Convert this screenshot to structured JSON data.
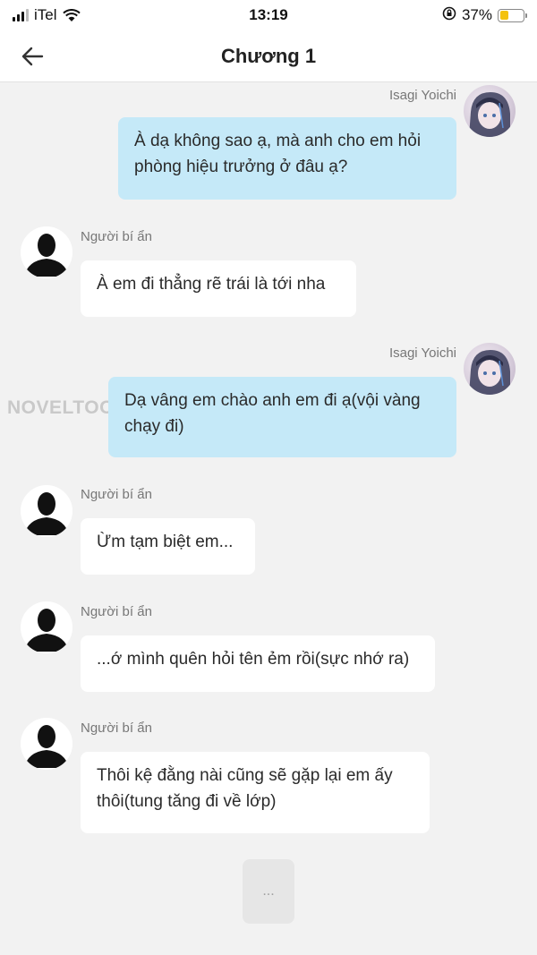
{
  "status_bar": {
    "carrier": "iTel",
    "time": "13:19",
    "battery_percent": "37%",
    "battery_level": 0.37
  },
  "header": {
    "title": "Chương 1"
  },
  "watermark": "NOVELTOON",
  "messages": [
    {
      "sender": "Isagi Yoichi",
      "text": "À dạ không sao ạ, mà anh cho em hỏi phòng hiệu trưởng ở đâu ạ?"
    },
    {
      "sender": "Người bí ẩn",
      "text": "À em đi thẳng rẽ trái là tới nha"
    },
    {
      "sender": "Isagi Yoichi",
      "text": "Dạ vâng em chào anh em đi ạ(vội vàng chạy đi)"
    },
    {
      "sender": "Người bí ẩn",
      "text": "Ừm tạm biệt em..."
    },
    {
      "sender": "Người bí ẩn",
      "text": "...ớ mình quên hỏi tên ẻm rồi(sực nhớ ra)"
    },
    {
      "sender": "Người bí ẩn",
      "text": "Thôi kệ đằng nài cũng sẽ gặp lại em ấy thôi(tung tăng đi về lớp)"
    }
  ],
  "typing_indicator": "...",
  "icons": {
    "back": "arrow-left-icon",
    "wifi": "wifi-icon",
    "lock_rotation": "rotation-lock-icon",
    "battery": "battery-icon",
    "avatar_me": "anime-avatar",
    "avatar_other": "silhouette-avatar"
  },
  "colors": {
    "bubble_me": "#c5e9f8",
    "bubble_other": "#ffffff",
    "background": "#f2f2f2",
    "battery": "#f4c20d"
  }
}
